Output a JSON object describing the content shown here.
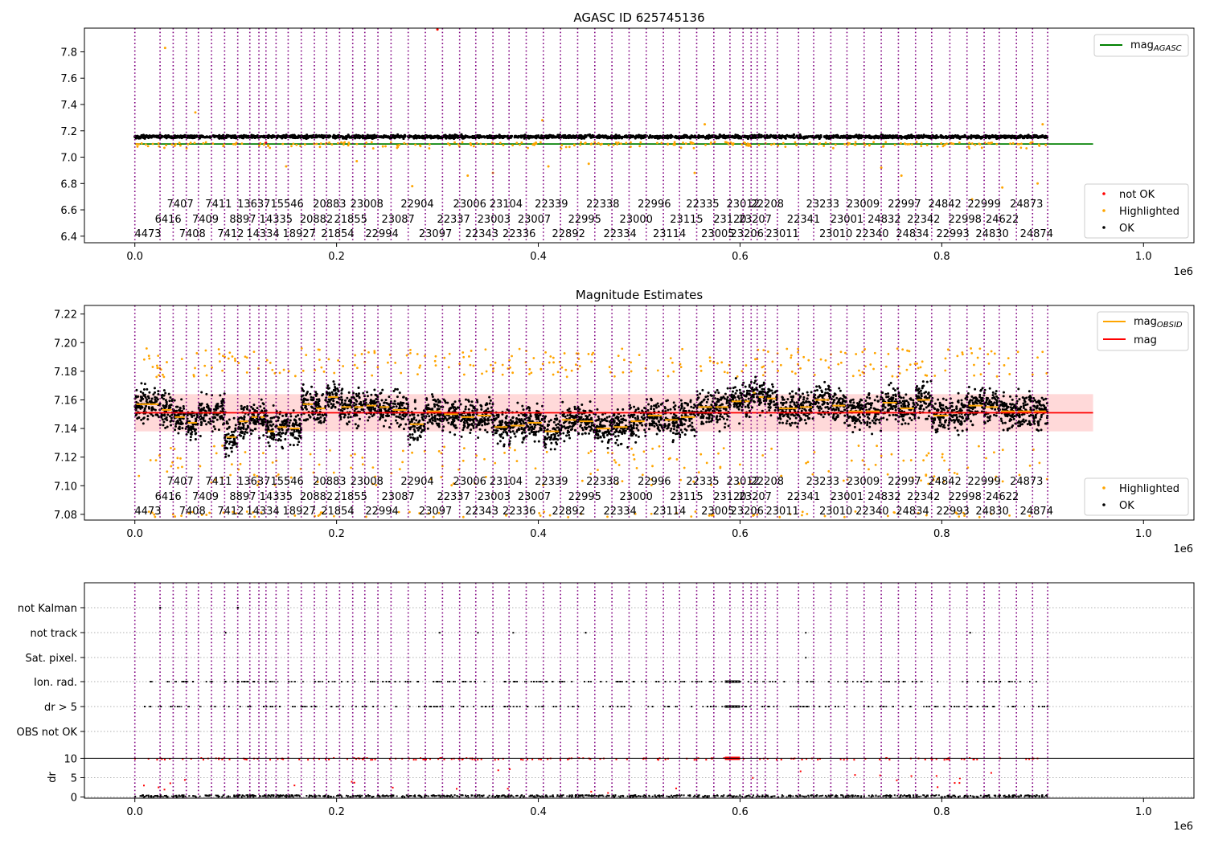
{
  "chart_data": [
    {
      "type": "scatter",
      "title": "AGASC ID 625745136",
      "xlim": [
        -50000,
        1050000
      ],
      "ylim": [
        6.35,
        7.98
      ],
      "xticks": [
        0,
        200000,
        400000,
        600000,
        800000,
        1000000
      ],
      "xtick_labels": [
        "0.0",
        "0.2",
        "0.4",
        "0.6",
        "0.8",
        "1.0"
      ],
      "x_offset_label": "1e6",
      "yticks": [
        6.4,
        6.6,
        6.8,
        7.0,
        7.2,
        7.4,
        7.6,
        7.8
      ],
      "ytick_labels": [
        "6.4",
        "6.6",
        "6.8",
        "7.0",
        "7.2",
        "7.4",
        "7.6",
        "7.8"
      ],
      "agasc_mag": 7.1,
      "agasc_line_x": [
        0,
        950000
      ],
      "ok_band": {
        "x": [
          0,
          905000
        ],
        "center": 7.155,
        "spread": 0.018
      },
      "highlighted_points": [
        [
          30000,
          7.83
        ],
        [
          60000,
          7.34
        ],
        [
          300000,
          7.97
        ],
        [
          404000,
          7.28
        ],
        [
          565000,
          7.25
        ],
        [
          900000,
          7.25
        ],
        [
          150000,
          6.93
        ],
        [
          220000,
          6.97
        ],
        [
          275000,
          6.78
        ],
        [
          330000,
          6.86
        ],
        [
          355000,
          6.88
        ],
        [
          410000,
          6.93
        ],
        [
          450000,
          6.95
        ],
        [
          555000,
          6.88
        ],
        [
          740000,
          6.92
        ],
        [
          760000,
          6.86
        ],
        [
          830000,
          6.68
        ],
        [
          860000,
          6.77
        ],
        [
          895000,
          6.8
        ]
      ],
      "not_ok_points": [
        [
          300000,
          7.97
        ],
        [
          130000,
          7.11
        ]
      ],
      "legend_upper": [
        {
          "label": "mag",
          "sub": "AGASC",
          "color": "#008000"
        }
      ],
      "legend_lower": [
        {
          "label": "not OK",
          "color": "#ff0000"
        },
        {
          "label": "Highlighted",
          "color": "#ffa500"
        },
        {
          "label": "OK",
          "color": "#000000"
        }
      ]
    },
    {
      "type": "scatter",
      "title": "Magnitude Estimates",
      "xlim": [
        -50000,
        1050000
      ],
      "ylim": [
        7.076,
        7.226
      ],
      "xticks": [
        0,
        200000,
        400000,
        600000,
        800000,
        1000000
      ],
      "xtick_labels": [
        "0.0",
        "0.2",
        "0.4",
        "0.6",
        "0.8",
        "1.0"
      ],
      "x_offset_label": "1e6",
      "yticks": [
        7.08,
        7.1,
        7.12,
        7.14,
        7.16,
        7.18,
        7.2,
        7.22
      ],
      "ytick_labels": [
        "7.08",
        "7.10",
        "7.12",
        "7.14",
        "7.16",
        "7.18",
        "7.20",
        "7.22"
      ],
      "mag": 7.151,
      "mag_band": [
        7.138,
        7.164
      ],
      "mag_line_x": [
        0,
        950000
      ],
      "obsid_mags": [
        7.157,
        7.153,
        7.148,
        7.144,
        7.151,
        7.151,
        7.134,
        7.145,
        7.148,
        7.148,
        7.138,
        7.141,
        7.14,
        7.157,
        7.154,
        7.162,
        7.155,
        7.155,
        7.156,
        7.155,
        7.153,
        7.143,
        7.152,
        7.15,
        7.148,
        7.149,
        7.141,
        7.142,
        7.144,
        7.138,
        7.146,
        7.145,
        7.14,
        7.141,
        7.145,
        7.149,
        7.146,
        7.148,
        7.155,
        7.155,
        7.159,
        7.159,
        7.165,
        7.162,
        7.161,
        7.154,
        7.155,
        7.16,
        7.156,
        7.152,
        7.152,
        7.158,
        7.154,
        7.16,
        7.149,
        7.151,
        7.156,
        7.155,
        7.152
      ],
      "legend_upper": [
        {
          "label": "mag",
          "sub": "OBSID",
          "color": "#ffa500"
        },
        {
          "label": "mag",
          "sub": "",
          "color": "#ff0000"
        }
      ],
      "legend_lower": [
        {
          "label": "Highlighted",
          "color": "#ffa500"
        },
        {
          "label": "OK",
          "color": "#000000"
        }
      ]
    },
    {
      "type": "scatter",
      "title": "",
      "xlim": [
        -50000,
        1050000
      ],
      "xticks": [
        0,
        200000,
        400000,
        600000,
        800000,
        1000000
      ],
      "xtick_labels": [
        "0.0",
        "0.2",
        "0.4",
        "0.6",
        "0.8",
        "1.0"
      ],
      "x_offset_label": "1e6",
      "flag_labels": [
        "not Kalman",
        "not track",
        "Sat. pixel.",
        "Ion. rad.",
        "dr > 5",
        "OBS not OK"
      ],
      "dr_ylabel": "dr",
      "dr_ylim": [
        -0.3,
        10.5
      ],
      "dr_yticks": [
        0,
        5,
        10
      ],
      "dr_ytick_labels": [
        "0",
        "5",
        "10"
      ],
      "dr_threshold": 10
    }
  ],
  "obs_x": [
    0,
    25000,
    38000,
    51000,
    63000,
    76000,
    89000,
    102000,
    114000,
    123000,
    130000,
    140000,
    152000,
    165000,
    178000,
    190000,
    203000,
    216000,
    228000,
    241000,
    254000,
    271000,
    288000,
    305000,
    322000,
    338000,
    355000,
    371000,
    388000,
    405000,
    422000,
    439000,
    456000,
    473000,
    490000,
    507000,
    524000,
    540000,
    557000,
    574000,
    590000,
    603000,
    611000,
    617000,
    625000,
    637000,
    658000,
    673000,
    690000,
    706000,
    723000,
    740000,
    757000,
    774000,
    790000,
    808000,
    825000,
    842000,
    857000,
    874000,
    890000,
    905000
  ],
  "obs_labels": [
    {
      "text": "7407",
      "x": 45000,
      "row": 0
    },
    {
      "text": "7411",
      "x": 83000,
      "row": 0
    },
    {
      "text": "13637",
      "x": 118000,
      "row": 0
    },
    {
      "text": "15546",
      "x": 151000,
      "row": 0
    },
    {
      "text": "20883",
      "x": 193000,
      "row": 0
    },
    {
      "text": "23008",
      "x": 230000,
      "row": 0
    },
    {
      "text": "22904",
      "x": 280000,
      "row": 0
    },
    {
      "text": "23006",
      "x": 332000,
      "row": 0
    },
    {
      "text": "23104",
      "x": 368000,
      "row": 0
    },
    {
      "text": "22339",
      "x": 413000,
      "row": 0
    },
    {
      "text": "22338",
      "x": 464000,
      "row": 0
    },
    {
      "text": "22996",
      "x": 515000,
      "row": 0
    },
    {
      "text": "22335",
      "x": 563000,
      "row": 0
    },
    {
      "text": "23012",
      "x": 603000,
      "row": 0
    },
    {
      "text": "22208",
      "x": 627000,
      "row": 0
    },
    {
      "text": "23233",
      "x": 682000,
      "row": 0
    },
    {
      "text": "23009",
      "x": 722000,
      "row": 0
    },
    {
      "text": "22997",
      "x": 763000,
      "row": 0
    },
    {
      "text": "24842",
      "x": 803000,
      "row": 0
    },
    {
      "text": "22999",
      "x": 842000,
      "row": 0
    },
    {
      "text": "24873",
      "x": 884000,
      "row": 0
    },
    {
      "text": "6416",
      "x": 33000,
      "row": 1
    },
    {
      "text": "7409",
      "x": 70000,
      "row": 1
    },
    {
      "text": "8897",
      "x": 107000,
      "row": 1
    },
    {
      "text": "14335",
      "x": 140000,
      "row": 1
    },
    {
      "text": "20882",
      "x": 180000,
      "row": 1
    },
    {
      "text": "21855",
      "x": 214000,
      "row": 1
    },
    {
      "text": "23087",
      "x": 261000,
      "row": 1
    },
    {
      "text": "22337",
      "x": 316000,
      "row": 1
    },
    {
      "text": "23003",
      "x": 356000,
      "row": 1
    },
    {
      "text": "23007",
      "x": 396000,
      "row": 1
    },
    {
      "text": "22995",
      "x": 446000,
      "row": 1
    },
    {
      "text": "23000",
      "x": 497000,
      "row": 1
    },
    {
      "text": "23115",
      "x": 547000,
      "row": 1
    },
    {
      "text": "23120",
      "x": 590000,
      "row": 1
    },
    {
      "text": "23207",
      "x": 615000,
      "row": 1
    },
    {
      "text": "22341",
      "x": 663000,
      "row": 1
    },
    {
      "text": "23001",
      "x": 706000,
      "row": 1
    },
    {
      "text": "24832",
      "x": 743000,
      "row": 1
    },
    {
      "text": "22342",
      "x": 782000,
      "row": 1
    },
    {
      "text": "22998",
      "x": 823000,
      "row": 1
    },
    {
      "text": "24622",
      "x": 860000,
      "row": 1
    },
    {
      "text": "4473",
      "x": 13000,
      "row": 2
    },
    {
      "text": "7408",
      "x": 57000,
      "row": 2
    },
    {
      "text": "7412",
      "x": 95000,
      "row": 2
    },
    {
      "text": "14334",
      "x": 127000,
      "row": 2
    },
    {
      "text": "18927",
      "x": 163000,
      "row": 2
    },
    {
      "text": "21854",
      "x": 201000,
      "row": 2
    },
    {
      "text": "22994",
      "x": 245000,
      "row": 2
    },
    {
      "text": "23097",
      "x": 298000,
      "row": 2
    },
    {
      "text": "22343",
      "x": 344000,
      "row": 2
    },
    {
      "text": "22336",
      "x": 381000,
      "row": 2
    },
    {
      "text": "22892",
      "x": 430000,
      "row": 2
    },
    {
      "text": "22334",
      "x": 481000,
      "row": 2
    },
    {
      "text": "23114",
      "x": 530000,
      "row": 2
    },
    {
      "text": "23005",
      "x": 578000,
      "row": 2
    },
    {
      "text": "23206",
      "x": 607000,
      "row": 2
    },
    {
      "text": "23011",
      "x": 642000,
      "row": 2
    },
    {
      "text": "23010",
      "x": 695000,
      "row": 2
    },
    {
      "text": "22340",
      "x": 731000,
      "row": 2
    },
    {
      "text": "24834",
      "x": 771000,
      "row": 2
    },
    {
      "text": "22993",
      "x": 811000,
      "row": 2
    },
    {
      "text": "24830",
      "x": 850000,
      "row": 2
    },
    {
      "text": "24874",
      "x": 894000,
      "row": 2
    }
  ],
  "colors": {
    "obs_lines": "#800080",
    "ok": "#000000",
    "highlighted": "#ffa500",
    "not_ok": "#ff0000",
    "agasc": "#008000",
    "mag": "#ff0000",
    "mag_band": "#ffcccc"
  }
}
